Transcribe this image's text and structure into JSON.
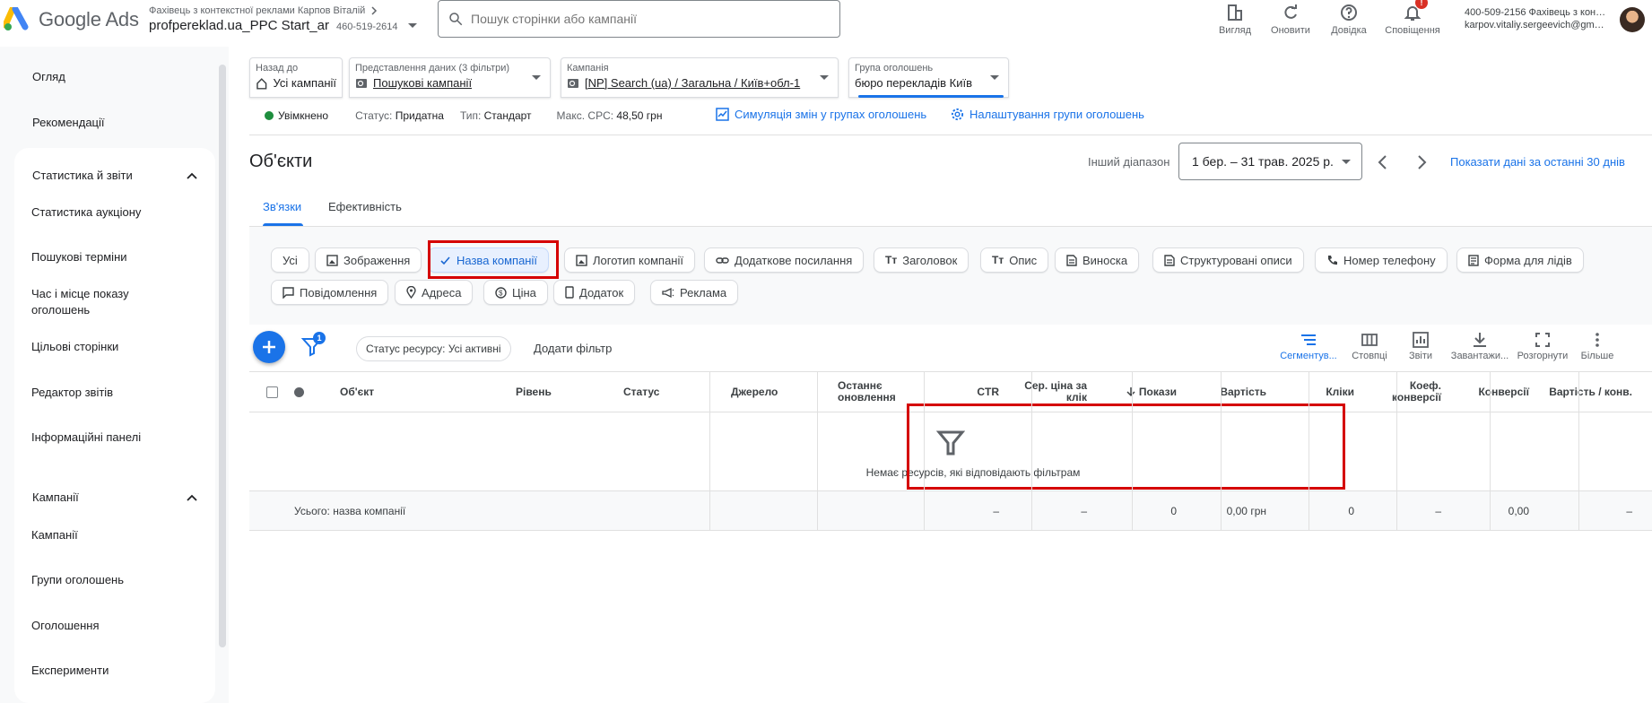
{
  "app": {
    "brand": "Google Ads",
    "account_owner": "Фахівець з контекстної реклами Карпов Віталій",
    "account_name": "profpereklad.ua_PPC Start_ar",
    "account_id": "460-519-2614",
    "search_placeholder": "Пошук сторінки або кампанії",
    "top_buttons": [
      {
        "icon": "view-icon",
        "label": "Вигляд"
      },
      {
        "icon": "refresh-icon",
        "label": "Оновити"
      },
      {
        "icon": "help-icon",
        "label": "Довідка"
      },
      {
        "icon": "bell-icon",
        "label": "Сповіщення",
        "badge": "!"
      }
    ],
    "user_line1": "400-509-2156 Фахівець з кон…",
    "user_line2": "karpov.vitaliy.sergeevich@gm…"
  },
  "sidebar": {
    "top_items": [
      "Огляд",
      "Рекомендації"
    ],
    "sections": [
      {
        "title": "Статистика й звіти",
        "items": [
          "Статистика аукціону",
          "Пошукові терміни",
          "Час і місце показу оголошень",
          "Цільові сторінки",
          "Редактор звітів",
          "Інформаційні панелі"
        ]
      },
      {
        "title": "Кампанії",
        "items": [
          "Кампанії",
          "Групи оголошень",
          "Оголошення",
          "Експерименти"
        ]
      }
    ]
  },
  "selectors": {
    "back": {
      "caption": "Назад до",
      "value": "Усі кампанії"
    },
    "view": {
      "caption": "Представлення даних (3 фільтри)",
      "value": "Пошукові кампанії"
    },
    "campaign": {
      "caption": "Кампанія",
      "value": "[NP] Search (ua) / Загальна / Київ+обл-1"
    },
    "adgroup": {
      "caption": "Група оголошень",
      "value": "бюро перекладів Київ"
    }
  },
  "status": {
    "enabled": "Увімкнено",
    "status_label": "Статус:",
    "status_value": "Придатна",
    "type_label": "Тип:",
    "type_value": "Стандарт",
    "cpc_label": "Макс. CPC:",
    "cpc_value": "48,50 грн",
    "link_sim": "Симуляція змін у групах оголошень",
    "link_settings": "Налаштування групи оголошень"
  },
  "page": {
    "title": "Об'єкти",
    "range_label": "Інший діапазон",
    "range_value": "1 бер. – 31 трав. 2025 р.",
    "last30": "Показати дані за останні 30 днів",
    "tabs": [
      "Зв'язки",
      "Ефективність"
    ]
  },
  "chips": [
    {
      "label": "Усі",
      "icon": "",
      "selected": false
    },
    {
      "label": "Зображення",
      "icon": "image-icon",
      "selected": false
    },
    {
      "label": "Назва компанії",
      "icon": "check-icon",
      "selected": true
    },
    {
      "label": "Логотип компанії",
      "icon": "image-icon",
      "selected": false
    },
    {
      "label": "Додаткове посилання",
      "icon": "link-icon",
      "selected": false
    },
    {
      "label": "Заголовок",
      "icon": "text-icon",
      "selected": false
    },
    {
      "label": "Опис",
      "icon": "text-icon",
      "selected": false
    },
    {
      "label": "Виноска",
      "icon": "doc-icon",
      "selected": false
    },
    {
      "label": "Структуровані описи",
      "icon": "doc-icon",
      "selected": false
    },
    {
      "label": "Номер телефону",
      "icon": "phone-icon",
      "selected": false
    },
    {
      "label": "Форма для лідів",
      "icon": "form-icon",
      "selected": false
    },
    {
      "label": "Повідомлення",
      "icon": "message-icon",
      "selected": false
    },
    {
      "label": "Адреса",
      "icon": "pin-icon",
      "selected": false
    },
    {
      "label": "Ціна",
      "icon": "price-icon",
      "selected": false
    },
    {
      "label": "Додаток",
      "icon": "app-icon",
      "selected": false
    },
    {
      "label": "Реклама",
      "icon": "megaphone-icon",
      "selected": false
    }
  ],
  "toolbar": {
    "filter_count": "1",
    "status_chip": "Статус ресурсу: Усі активні",
    "add_filter": "Додати фільтр",
    "tools": [
      {
        "icon": "segment-icon",
        "label": "Сегментув..."
      },
      {
        "icon": "columns-icon",
        "label": "Стовпці"
      },
      {
        "icon": "reports-icon",
        "label": "Звіти"
      },
      {
        "icon": "download-icon",
        "label": "Завантажи..."
      },
      {
        "icon": "expand-icon",
        "label": "Розгорнути"
      },
      {
        "icon": "more-icon",
        "label": "Більше"
      }
    ]
  },
  "table": {
    "headers": [
      "Об'єкт",
      "Рівень",
      "Статус",
      "Джерело",
      "Останнє оновлення",
      "CTR",
      "Сер. ціна за клік",
      "Покази",
      "Вартість",
      "Кліки",
      "Коеф. конверсії",
      "Конверсії",
      "Вартість / конв."
    ],
    "sorted_column": "Покази",
    "empty_message": "Немає ресурсів, які відповідають фільтрам",
    "total": {
      "label": "Усього: назва компанії",
      "ctr": "–",
      "avg_cpc": "–",
      "impressions": "0",
      "cost": "0,00 грн",
      "clicks": "0",
      "conv_rate": "–",
      "conversions": "0,00",
      "cost_per_conv": "–"
    }
  },
  "colors": {
    "accent": "#1a73e8",
    "highlight": "#d50000",
    "enabled": "#1e8e3e"
  }
}
